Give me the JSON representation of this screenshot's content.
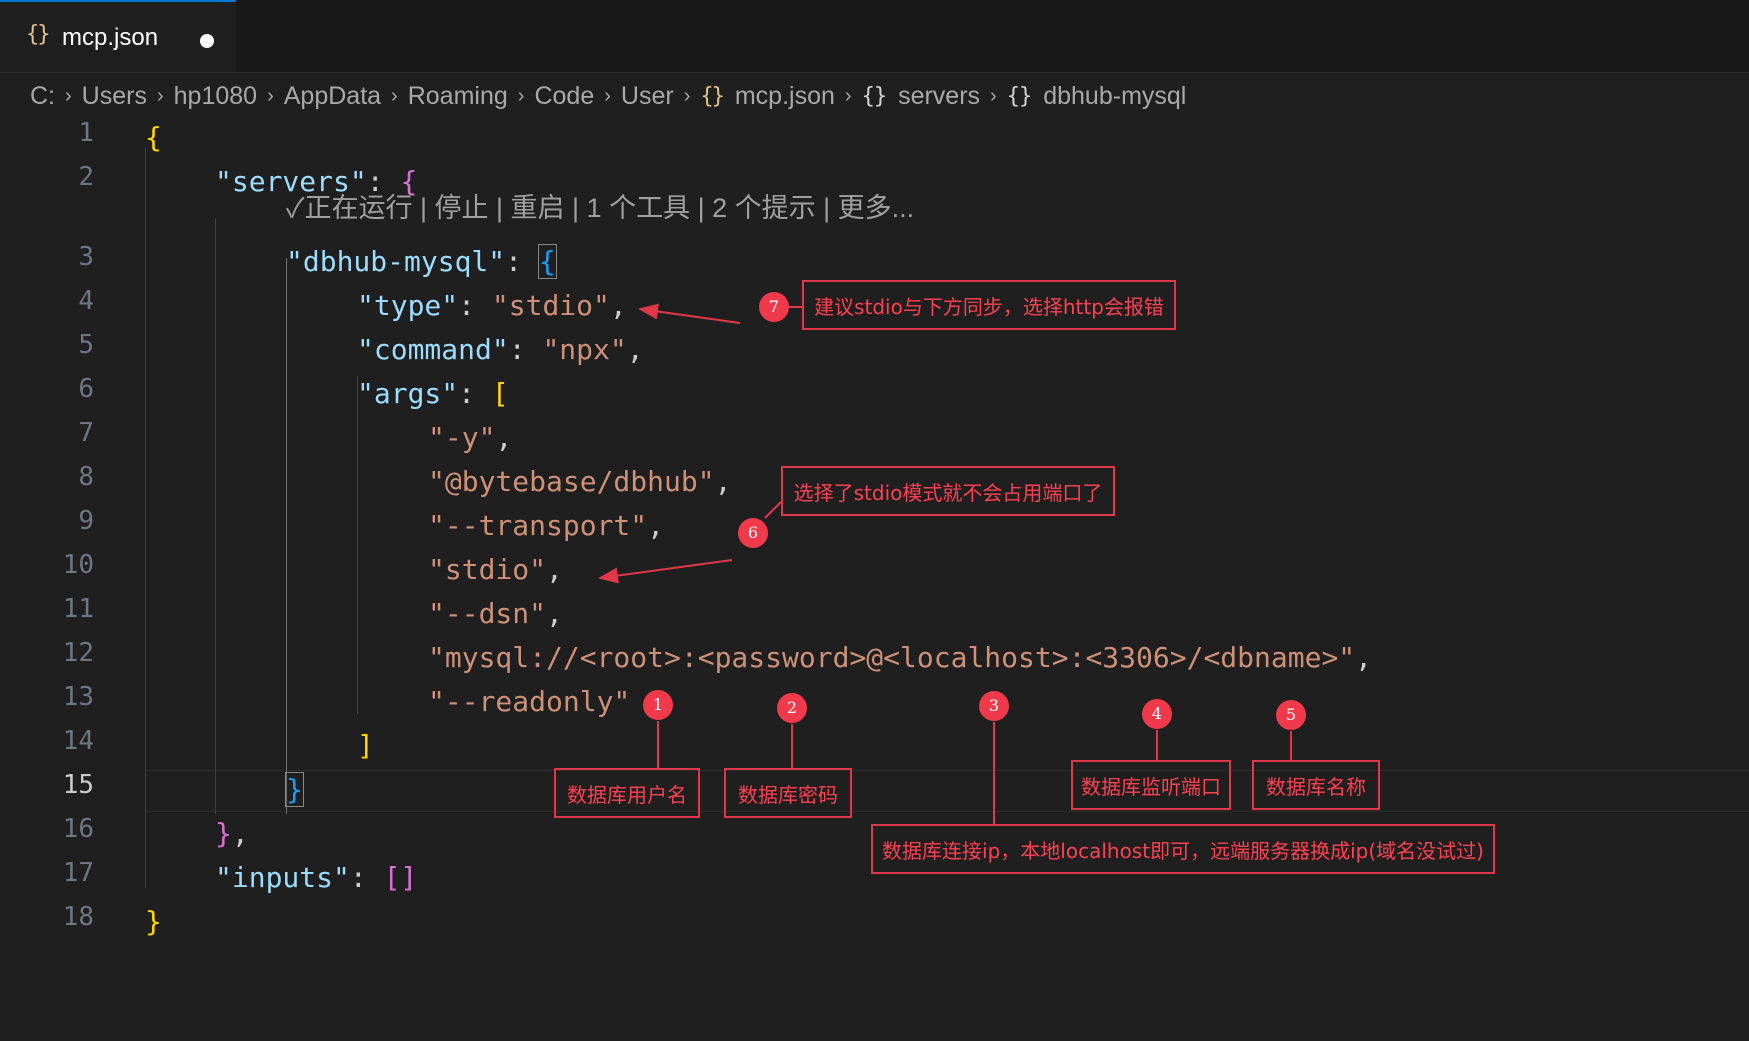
{
  "tab": {
    "icon": "json-file-icon",
    "label": "mcp.json",
    "dirty_indicator": "unsaved-dot"
  },
  "breadcrumb": {
    "items": [
      "C:",
      "Users",
      "hp1080",
      "AppData",
      "Roaming",
      "Code",
      "User",
      "mcp.json",
      "servers",
      "dbhub-mysql"
    ]
  },
  "editor": {
    "active_line": 15,
    "line_numbers": [
      "1",
      "2",
      "3",
      "4",
      "5",
      "6",
      "7",
      "8",
      "9",
      "10",
      "11",
      "12",
      "13",
      "14",
      "15",
      "16",
      "17",
      "18"
    ],
    "codelens": {
      "running": "✓正在运行",
      "stop": "停止",
      "restart": "重启",
      "tools": "1 个工具",
      "prompts": "2 个提示",
      "more": "更多..."
    },
    "code": {
      "key_servers": "\"servers\"",
      "key_dbhub": "\"dbhub-mysql\"",
      "key_type": "\"type\"",
      "val_type": "\"stdio\"",
      "key_command": "\"command\"",
      "val_command": "\"npx\"",
      "key_args": "\"args\"",
      "arg_1": "\"-y\"",
      "arg_2": "\"@bytebase/dbhub\"",
      "arg_3": "\"--transport\"",
      "arg_4": "\"stdio\"",
      "arg_5": "\"--dsn\"",
      "arg_6": "\"mysql://<root>:<password>@<localhost>:<3306>/<dbname>\"",
      "arg_7": "\"--readonly\"",
      "key_inputs": "\"inputs\""
    }
  },
  "annotations": [
    {
      "num": "1",
      "text": "数据库用户名"
    },
    {
      "num": "2",
      "text": "数据库密码"
    },
    {
      "num": "3",
      "text": "数据库连接ip，本地localhost即可，远端服务器换成ip(域名没试过)"
    },
    {
      "num": "4",
      "text": "数据库监听端口"
    },
    {
      "num": "5",
      "text": "数据库名称"
    },
    {
      "num": "6",
      "text": "选择了stdio模式就不会占用端口了"
    },
    {
      "num": "7",
      "text": "建议stdio与下方同步，选择http会报错"
    }
  ],
  "colors": {
    "annotation_red": "#e0384a",
    "key_blue": "#9cdcfe",
    "string_orange": "#ce9178",
    "bracket_gold": "#ffd700",
    "bracket_purple": "#da70d6",
    "bracket_blue": "#179fff"
  }
}
